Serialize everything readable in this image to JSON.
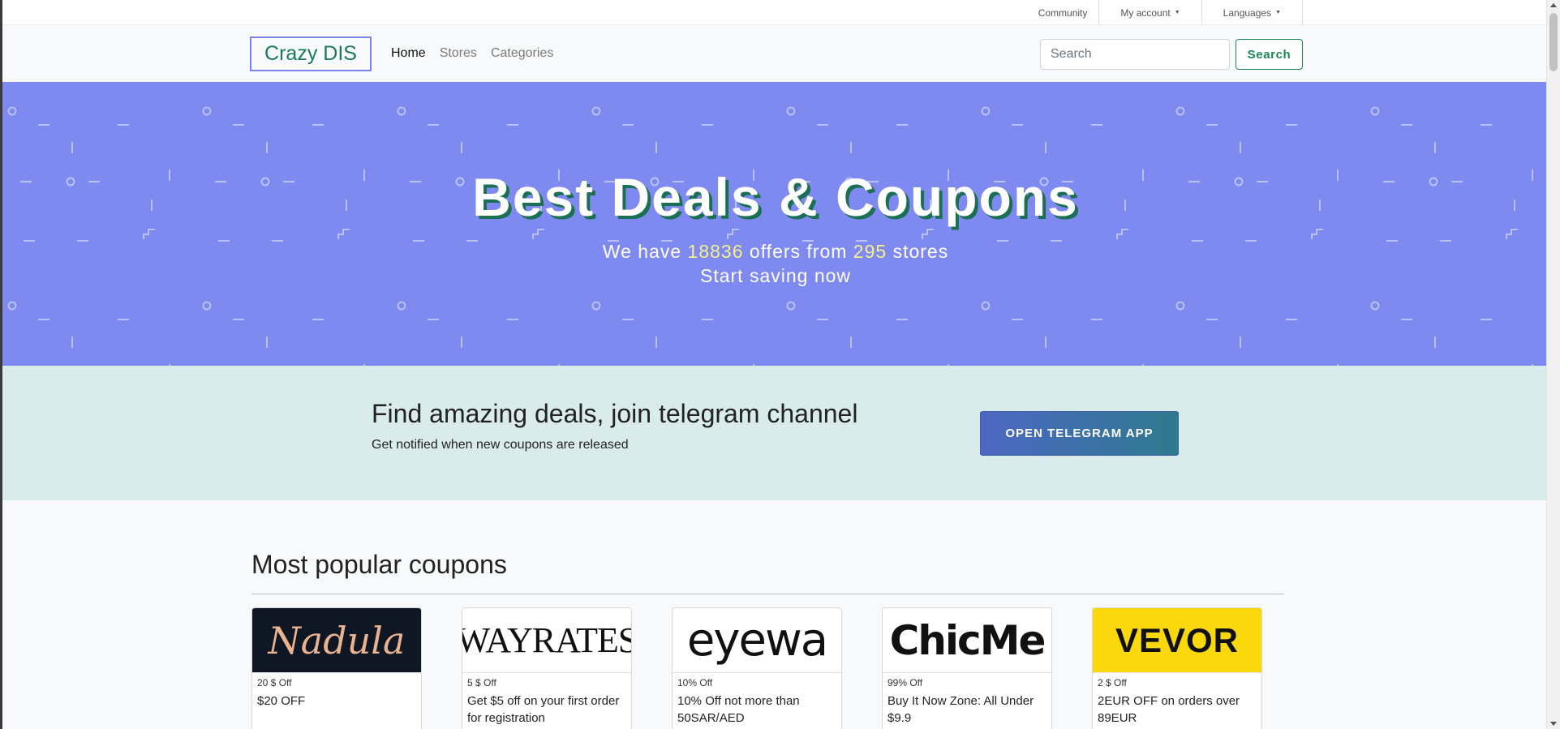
{
  "topbar": {
    "community": "Community",
    "my_account": "My account",
    "languages": "Languages"
  },
  "navbar": {
    "brand": "Crazy DIS",
    "links": {
      "home": "Home",
      "stores": "Stores",
      "categories": "Categories"
    },
    "search_placeholder": "Search",
    "search_button": "Search"
  },
  "hero": {
    "title": "Best Deals & Coupons",
    "line1_prefix": "We have",
    "offers_count": "18836",
    "line1_middle": "offers from",
    "stores_count": "295",
    "line1_suffix": "stores",
    "line2": "Start saving now"
  },
  "telegram": {
    "title": "Find amazing deals, join telegram channel",
    "subtitle": "Get notified when new coupons are released",
    "button": "OPEN TELEGRAM APP"
  },
  "popular": {
    "title": "Most popular coupons",
    "coupons": [
      {
        "logo_text": "Nadula",
        "discount": "20 $ Off",
        "description": "$20 OFF"
      },
      {
        "logo_text": "WAYRATES",
        "discount": "5 $ Off",
        "description": "Get $5 off on your first order for registration"
      },
      {
        "logo_text": "eyewa",
        "discount": "10% Off",
        "description": "10% Off not more than 50SAR/AED"
      },
      {
        "logo_text": "ChicMe",
        "discount": "99% Off",
        "description": "Buy It Now Zone: All Under $9.9"
      },
      {
        "logo_text": "VEVOR",
        "discount": "2 $ Off",
        "description": "2EUR OFF on orders over 89EUR"
      }
    ]
  },
  "colors": {
    "hero_bg": "#7f8af0",
    "brand_green": "#198754",
    "telegram_bg": "#d9ebea",
    "highlight_yellow": "#f4f08a"
  }
}
